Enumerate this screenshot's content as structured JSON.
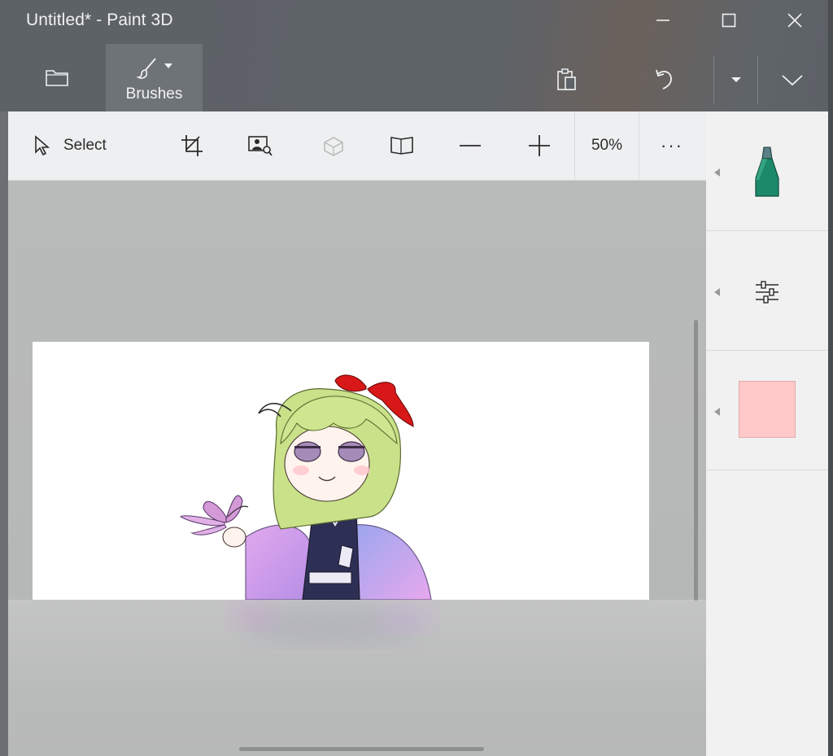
{
  "window": {
    "title": "Untitled* - Paint 3D",
    "controls": [
      "minimize-icon",
      "maximize-icon",
      "close-icon"
    ]
  },
  "ribbon": {
    "menu_icon": "folder-icon",
    "brushes_label": "Brushes",
    "brushes_icon": "paintbrush-icon",
    "right_icons": [
      "paste-icon",
      "undo-icon",
      "history-dropdown-icon",
      "collapse-ribbon-icon"
    ]
  },
  "toolbar": {
    "select_label": "Select",
    "tools": [
      "select-arrow-icon",
      "crop-icon",
      "magic-select-icon",
      "3d-view-icon",
      "canvas-icon",
      "zoom-out-icon",
      "zoom-in-icon"
    ],
    "zoom_level": "50%",
    "more_label": "···"
  },
  "side_panel": {
    "sections": [
      "marker-tool-icon",
      "settings-sliders-icon",
      "color-swatch"
    ],
    "current_color": "#ffc9c9",
    "marker_color": "#1c8a6a"
  },
  "colors": {
    "title_bar": "#5d6267",
    "toolbar": "#eeeff0",
    "workspace": "#b9baba",
    "canvas": "#ffffff"
  }
}
